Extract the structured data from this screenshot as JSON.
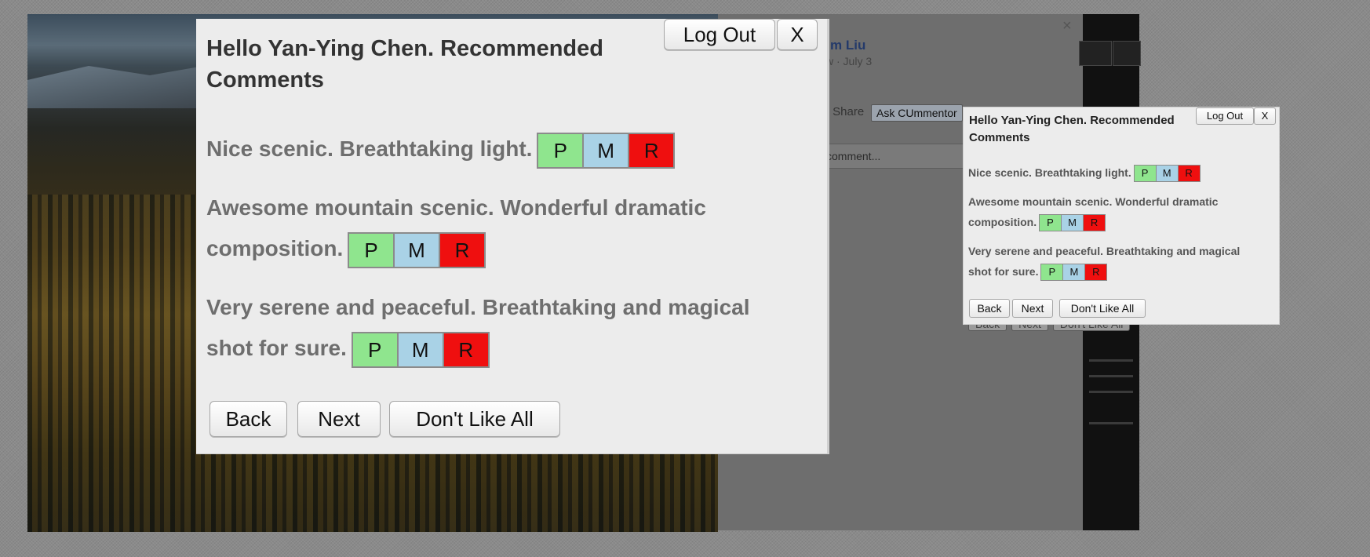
{
  "facebook": {
    "author": "m Liu",
    "date": "w · July 3",
    "share": "· Share",
    "ask_button": "Ask CUmmentor",
    "comment_placeholder": "comment...",
    "close_glyph": "×"
  },
  "big_dialog": {
    "title": "Hello Yan-Ying Chen. Recommended Comments",
    "logout": "Log Out",
    "close": "X",
    "comments": [
      {
        "text": "Nice scenic. Breathtaking light.",
        "p": "P",
        "m": "M",
        "r": "R"
      },
      {
        "text_line1": "Awesome mountain scenic. Wonderful dramatic",
        "text_line2": "composition.",
        "p": "P",
        "m": "M",
        "r": "R"
      },
      {
        "text_line1": "Very serene and peaceful. Breathtaking and magical",
        "text_line2": "shot for sure.",
        "p": "P",
        "m": "M",
        "r": "R"
      }
    ],
    "back": "Back",
    "next": "Next",
    "dont_like_all": "Don't Like All"
  },
  "small_dialog": {
    "title": "Hello Yan-Ying Chen. Recommended Comments",
    "logout": "Log Out",
    "close": "X",
    "comments": [
      {
        "text": "Nice scenic. Breathtaking light.",
        "p": "P",
        "m": "M",
        "r": "R"
      },
      {
        "text_line1": "Awesome mountain scenic. Wonderful dramatic",
        "text_line2": "composition.",
        "p": "P",
        "m": "M",
        "r": "R"
      },
      {
        "text_line1": "Very serene and peaceful. Breathtaking and magical",
        "text_line2": "shot for sure.",
        "p": "P",
        "m": "M",
        "r": "R"
      }
    ],
    "back": "Back",
    "next": "Next",
    "dont_like_all": "Don't Like All"
  },
  "colors": {
    "positive": "#8fe58e",
    "mild": "#a9d2e6",
    "reject": "#ef0f0f"
  }
}
